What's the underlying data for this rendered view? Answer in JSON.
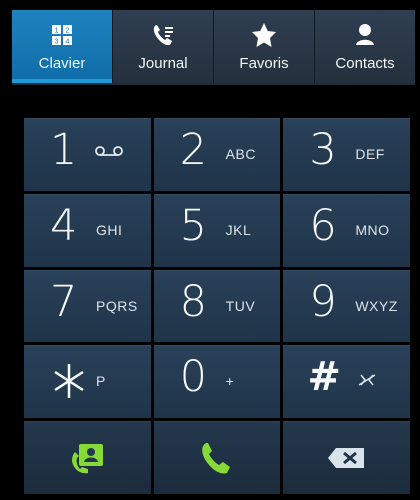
{
  "tabs": [
    {
      "label": "Clavier",
      "icon": "keypad-icon",
      "active": true
    },
    {
      "label": "Journal",
      "icon": "call-log-icon"
    },
    {
      "label": "Favoris",
      "icon": "star-icon"
    },
    {
      "label": "Contacts",
      "icon": "person-icon"
    }
  ],
  "keys": [
    {
      "digit": "1",
      "letters": ""
    },
    {
      "digit": "2",
      "letters": "ABC"
    },
    {
      "digit": "3",
      "letters": "DEF"
    },
    {
      "digit": "4",
      "letters": "GHI"
    },
    {
      "digit": "5",
      "letters": "JKL"
    },
    {
      "digit": "6",
      "letters": "MNO"
    },
    {
      "digit": "7",
      "letters": "PQRS"
    },
    {
      "digit": "8",
      "letters": "TUV"
    },
    {
      "digit": "9",
      "letters": "WXYZ"
    },
    {
      "digit": "*",
      "letters": "P"
    },
    {
      "digit": "0",
      "letters": "+"
    },
    {
      "digit": "#",
      "letters": ""
    }
  ],
  "actions": {
    "contact_icon": "contact-card-icon",
    "call_icon": "phone-call-icon",
    "delete_icon": "backspace-icon"
  },
  "colors": {
    "active_tab": "#1679b8",
    "call_green": "#86d936"
  }
}
